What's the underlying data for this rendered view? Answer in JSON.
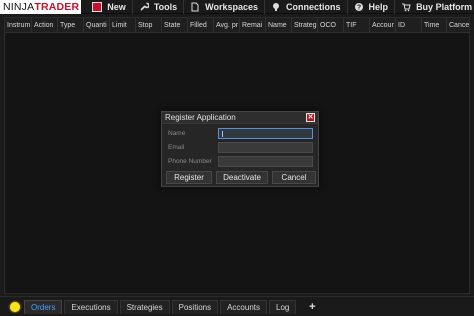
{
  "menubar": {
    "logo": {
      "part1": "NINJA",
      "part2": "TRADER"
    },
    "items": [
      {
        "label": "New",
        "icon": "new-icon"
      },
      {
        "label": "Tools",
        "icon": "wrench-icon"
      },
      {
        "label": "Workspaces",
        "icon": "document-icon"
      },
      {
        "label": "Connections",
        "icon": "plug-icon"
      },
      {
        "label": "Help",
        "icon": "help-icon"
      },
      {
        "label": "Buy Platform",
        "icon": "cart-icon"
      }
    ]
  },
  "grid": {
    "columns": [
      "Instrum",
      "Action",
      "Type",
      "Quanti",
      "Limit",
      "Stop",
      "State",
      "Filled",
      "Avg. pr",
      "Remai",
      "Name",
      "Strateg",
      "OCO",
      "TIF",
      "Accour",
      "ID",
      "Time",
      "Cance"
    ]
  },
  "dialog": {
    "title": "Register Application",
    "close_icon": "close-icon",
    "fields": [
      {
        "label": "Name",
        "value": ""
      },
      {
        "label": "Email",
        "value": ""
      },
      {
        "label": "Phone Number",
        "value": ""
      }
    ],
    "buttons": {
      "register": "Register",
      "deactivate": "Deactivate",
      "cancel": "Cancel"
    }
  },
  "tabbar": {
    "status_color": "#ffe31a",
    "tabs": [
      "Orders",
      "Executions",
      "Strategies",
      "Positions",
      "Accounts",
      "Log"
    ],
    "active_tab": "Orders",
    "add_label": "+"
  },
  "colors": {
    "accent": "#c8102e",
    "active_tab_text": "#4aa3ff",
    "background": "#1b1b1b"
  }
}
